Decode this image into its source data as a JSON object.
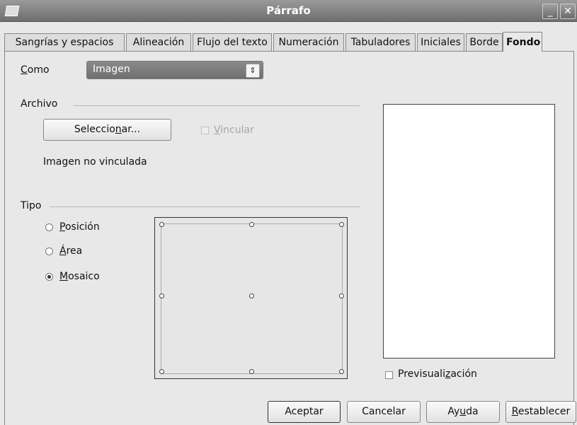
{
  "window": {
    "title": "Párrafo",
    "minimize_glyph": "_",
    "close_glyph": "✕"
  },
  "tabs": [
    {
      "label": "Sangrías y espacios"
    },
    {
      "label": "Alineación"
    },
    {
      "label": "Flujo del texto"
    },
    {
      "label": "Numeración"
    },
    {
      "label": "Tabuladores"
    },
    {
      "label": "Iniciales"
    },
    {
      "label": "Borde"
    },
    {
      "label": "Fondo",
      "active": true
    }
  ],
  "como": {
    "label_first": "C",
    "label_rest": "omo",
    "value": "Imagen",
    "arrow_glyph": "⇕"
  },
  "archivo": {
    "section_label": "Archivo",
    "select_button_a": "Seleccio",
    "select_button_u": "n",
    "select_button_b": "ar...",
    "vincular_u": "V",
    "vincular_rest": "incular",
    "vincular_checked": false,
    "status": "Imagen no vinculada"
  },
  "tipo": {
    "section_label": "Tipo",
    "options": [
      {
        "u": "P",
        "rest": "osición",
        "checked": false
      },
      {
        "u": "Á",
        "rest": "rea",
        "checked": false
      },
      {
        "u": "M",
        "rest": "osaico",
        "checked": true
      }
    ]
  },
  "preview": {
    "checkbox_a": "Previsuali",
    "checkbox_u": "z",
    "checkbox_b": "ación",
    "checked": false
  },
  "buttons": {
    "ok": "Aceptar",
    "cancel": "Cancelar",
    "help_a": "Ay",
    "help_u": "u",
    "help_b": "da",
    "reset_u": "R",
    "reset_rest": "establecer"
  },
  "colors": {
    "title_bar": "#7a7a7a",
    "select_bg": "#7d7d7d",
    "panel_bg": "#e8e8e8"
  }
}
